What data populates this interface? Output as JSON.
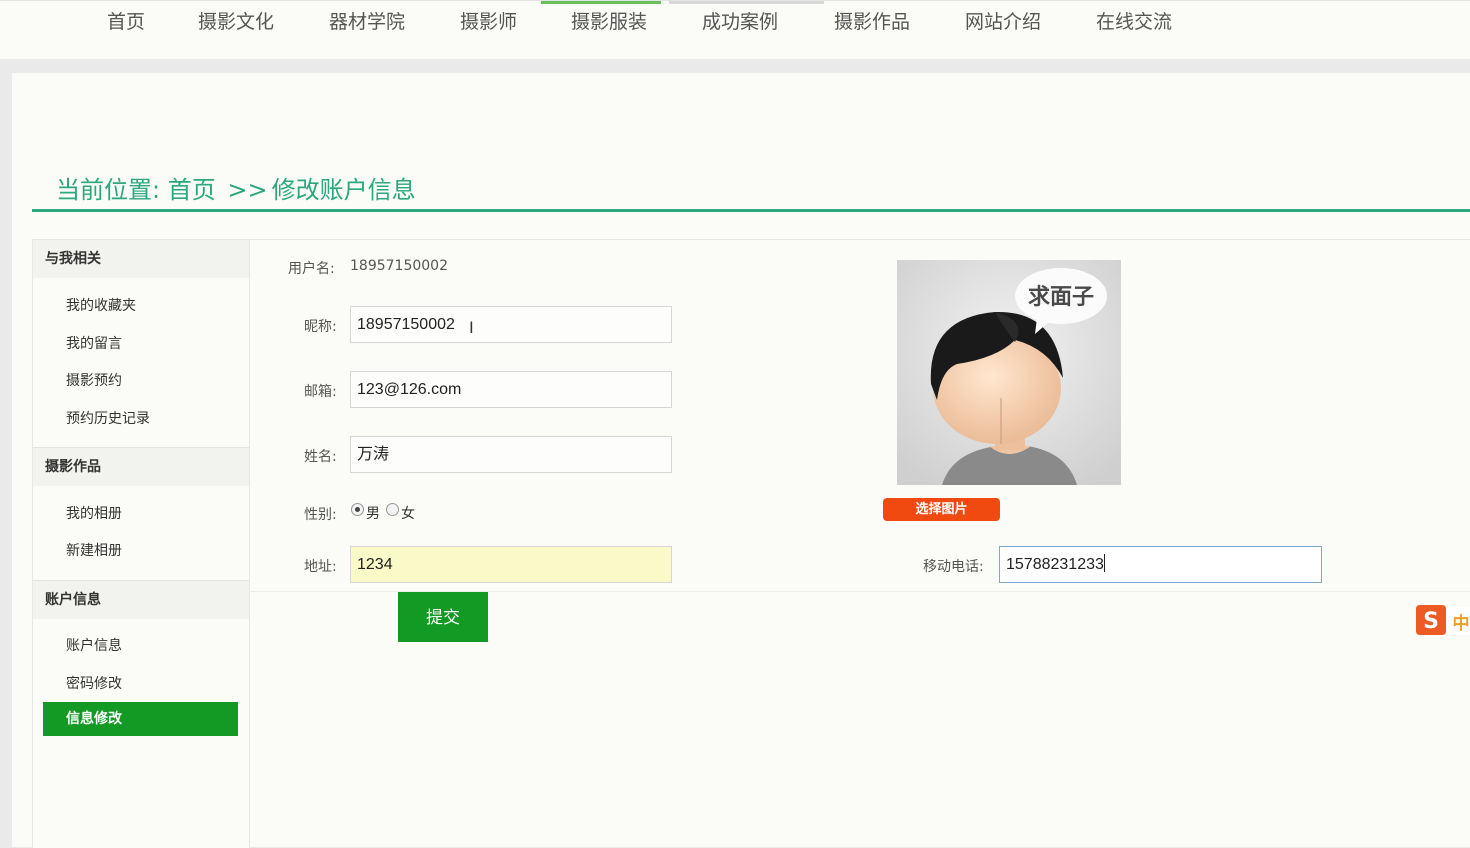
{
  "nav": {
    "items": [
      "首页",
      "摄影文化",
      "器材学院",
      "摄影师",
      "摄影服装",
      "成功案例",
      "摄影作品",
      "网站介绍",
      "在线交流"
    ]
  },
  "breadcrumb": {
    "prefix": "当前位置:",
    "home": "首页",
    "separator": ">>",
    "current": "修改账户信息"
  },
  "sidebar": {
    "groups": [
      {
        "title": "与我相关",
        "items": [
          "我的收藏夹",
          "我的留言",
          "摄影预约",
          "预约历史记录"
        ]
      },
      {
        "title": "摄影作品",
        "items": [
          "我的相册",
          "新建相册"
        ]
      },
      {
        "title": "账户信息",
        "items": [
          "账户信息",
          "密码修改",
          "信息修改"
        ]
      }
    ],
    "active_item": "信息修改"
  },
  "form": {
    "username_label": "用户名:",
    "username_value": "18957150002",
    "nickname_label": "昵称:",
    "nickname_value": "18957150002",
    "email_label": "邮箱:",
    "email_value": "123@126.com",
    "name_label": "姓名:",
    "name_value": "万涛",
    "gender_label": "性别:",
    "gender_options": [
      "男",
      "女"
    ],
    "gender_selected": "男",
    "address_label": "地址:",
    "address_value": "1234",
    "phone_label": "移动电话:",
    "phone_value": "15788231233",
    "choose_image_label": "选择图片",
    "avatar_caption": "求面子",
    "submit_label": "提交"
  },
  "colors": {
    "accent_green": "#2aa87e",
    "button_green": "#139a24",
    "orange_button": "#f04a11",
    "address_highlight": "#fafac8"
  },
  "ime": {
    "icon": "sogou-ime-icon",
    "label": "中"
  }
}
